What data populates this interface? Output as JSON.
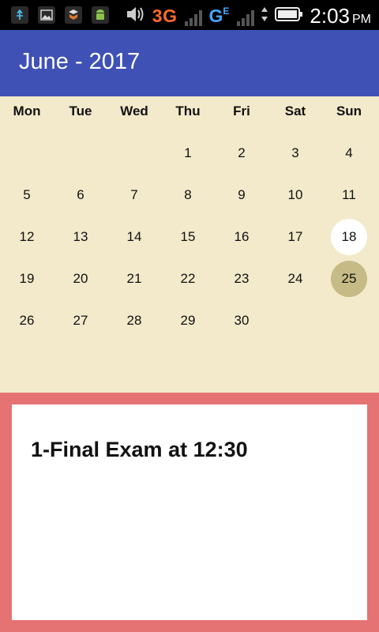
{
  "status_bar": {
    "icons": [
      "usb-icon",
      "image-icon",
      "security-icon",
      "android-icon"
    ],
    "network_label": "3G",
    "network_label_2": "G",
    "network_label_2_sub": "E",
    "time": "2:03",
    "ampm": "PM"
  },
  "app_bar": {
    "title": "June - 2017"
  },
  "calendar": {
    "weekdays": [
      "Mon",
      "Tue",
      "Wed",
      "Thu",
      "Fri",
      "Sat",
      "Sun"
    ],
    "weeks": [
      [
        "",
        "",
        "",
        "1",
        "2",
        "3",
        "4"
      ],
      [
        "5",
        "6",
        "7",
        "8",
        "9",
        "10",
        "11"
      ],
      [
        "12",
        "13",
        "14",
        "15",
        "16",
        "17",
        "18"
      ],
      [
        "19",
        "20",
        "21",
        "22",
        "23",
        "24",
        "25"
      ],
      [
        "26",
        "27",
        "28",
        "29",
        "30",
        "",
        ""
      ]
    ],
    "today": "18",
    "selected": "25"
  },
  "events": [
    {
      "text": "1-Final Exam at 12:30"
    }
  ],
  "colors": {
    "primary": "#3f51b5",
    "calendar_bg": "#f2eacb",
    "selected_day": "#c6bb86",
    "panel_border": "#e57373"
  }
}
